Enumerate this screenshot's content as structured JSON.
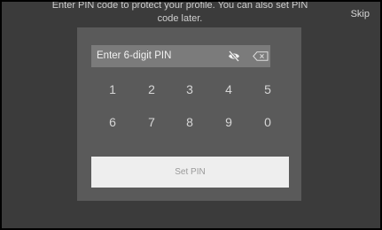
{
  "header": {
    "instruction": "Enter PIN code to protect your profile. You can also set PIN code later.",
    "skip_label": "Skip"
  },
  "pin_entry": {
    "placeholder": "Enter 6-digit PIN",
    "visibility_icon": "eye-off-icon",
    "delete_icon": "backspace-icon"
  },
  "keypad": {
    "row1": [
      "1",
      "2",
      "3",
      "4",
      "5"
    ],
    "row2": [
      "6",
      "7",
      "8",
      "9",
      "0"
    ]
  },
  "actions": {
    "set_pin_label": "Set PIN"
  }
}
